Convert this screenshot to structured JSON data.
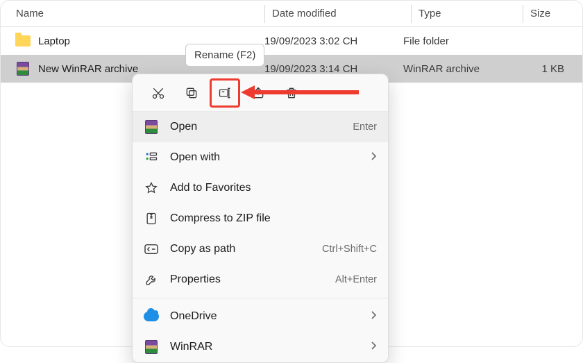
{
  "columns": {
    "name": "Name",
    "date": "Date modified",
    "type": "Type",
    "size": "Size"
  },
  "rows": [
    {
      "name": "Laptop",
      "date": "19/09/2023 3:02 CH",
      "type": "File folder",
      "size": ""
    },
    {
      "name": "New WinRAR archive",
      "date": "19/09/2023 3:14 CH",
      "type": "WinRAR archive",
      "size": "1 KB"
    }
  ],
  "tooltip": "Rename (F2)",
  "menu": {
    "open": {
      "label": "Open",
      "shortcut": "Enter"
    },
    "open_with": {
      "label": "Open with"
    },
    "favorites": {
      "label": "Add to Favorites"
    },
    "zip": {
      "label": "Compress to ZIP file"
    },
    "copy_path": {
      "label": "Copy as path",
      "shortcut": "Ctrl+Shift+C"
    },
    "properties": {
      "label": "Properties",
      "shortcut": "Alt+Enter"
    },
    "onedrive": {
      "label": "OneDrive"
    },
    "winrar": {
      "label": "WinRAR"
    }
  },
  "annotation_color": "#ef3b2f"
}
